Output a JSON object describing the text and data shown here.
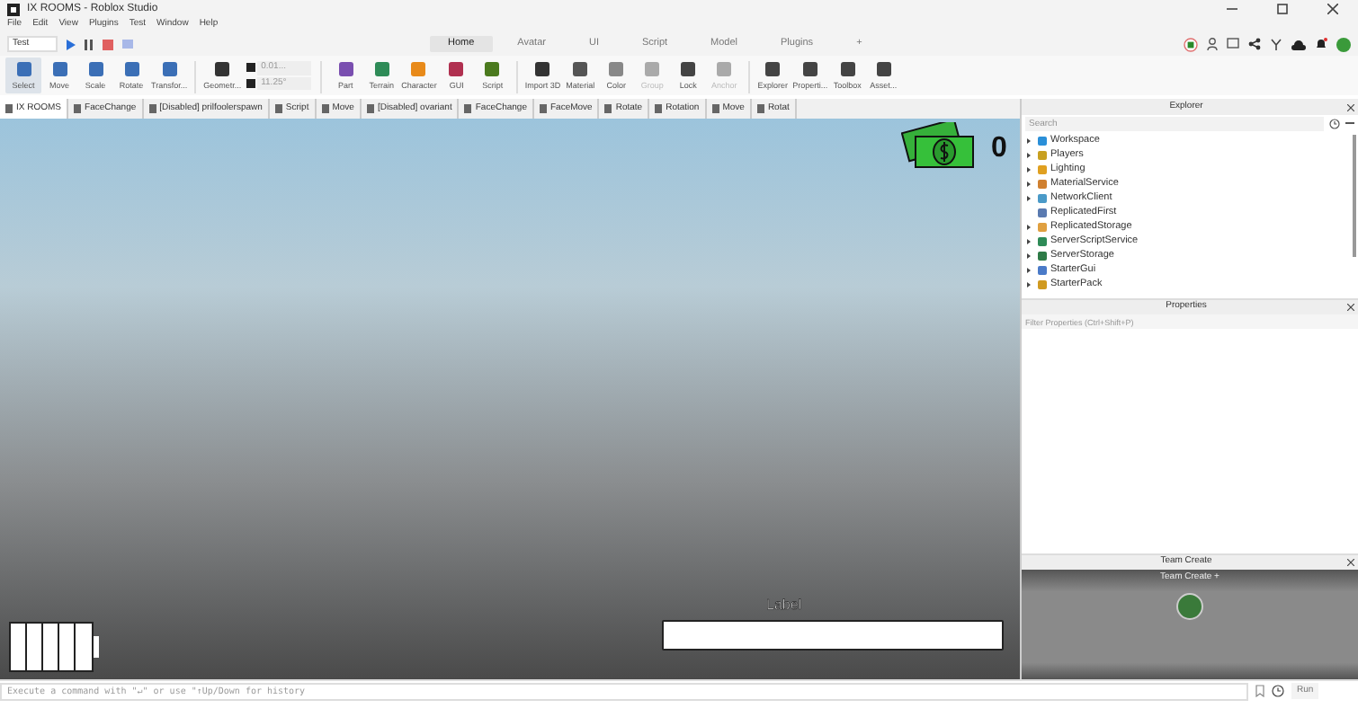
{
  "window": {
    "title": "IX ROOMS - Roblox Studio"
  },
  "menu": [
    "File",
    "Edit",
    "View",
    "Plugins",
    "Test",
    "Window",
    "Help"
  ],
  "test_dropdown": {
    "value": "Test"
  },
  "ribbon_tabs": [
    {
      "label": "Home",
      "selected": true
    },
    {
      "label": "Avatar",
      "selected": false
    },
    {
      "label": "UI",
      "selected": false
    },
    {
      "label": "Script",
      "selected": false
    },
    {
      "label": "Model",
      "selected": false
    },
    {
      "label": "Plugins",
      "selected": false
    },
    {
      "label": "+",
      "selected": false
    }
  ],
  "tools": [
    {
      "label": "Select",
      "color": "#3b6fb6",
      "selected": true,
      "disabled": false
    },
    {
      "label": "Move",
      "color": "#3b6fb6",
      "selected": false,
      "disabled": false
    },
    {
      "label": "Scale",
      "color": "#3b6fb6",
      "selected": false,
      "disabled": false
    },
    {
      "label": "Rotate",
      "color": "#3b6fb6",
      "selected": false,
      "disabled": false
    },
    {
      "label": "Transfor...",
      "color": "#3b6fb6",
      "selected": false,
      "disabled": false
    },
    {
      "label": "Geometr...",
      "color": "#333333",
      "selected": false,
      "disabled": false
    },
    {
      "label": "Part",
      "color": "#7a4fb0",
      "selected": false,
      "disabled": false
    },
    {
      "label": "Terrain",
      "color": "#2e8b57",
      "selected": false,
      "disabled": false
    },
    {
      "label": "Character",
      "color": "#e88a1a",
      "selected": false,
      "disabled": false
    },
    {
      "label": "GUI",
      "color": "#b03050",
      "selected": false,
      "disabled": false
    },
    {
      "label": "Script",
      "color": "#4b7a1e",
      "selected": false,
      "disabled": false
    },
    {
      "label": "Import 3D",
      "color": "#333333",
      "selected": false,
      "disabled": false
    },
    {
      "label": "Material",
      "color": "#555555",
      "selected": false,
      "disabled": false
    },
    {
      "label": "Color",
      "color": "#888888",
      "selected": false,
      "disabled": false
    },
    {
      "label": "Group",
      "color": "#aaaaaa",
      "selected": false,
      "disabled": true
    },
    {
      "label": "Lock",
      "color": "#444444",
      "selected": false,
      "disabled": false
    },
    {
      "label": "Anchor",
      "color": "#aaaaaa",
      "selected": false,
      "disabled": true
    },
    {
      "label": "Explorer",
      "color": "#444444",
      "selected": false,
      "disabled": false
    },
    {
      "label": "Properti...",
      "color": "#444444",
      "selected": false,
      "disabled": false
    },
    {
      "label": "Toolbox",
      "color": "#444444",
      "selected": false,
      "disabled": false
    },
    {
      "label": "Asset...",
      "color": "#444444",
      "selected": false,
      "disabled": false
    }
  ],
  "snap": [
    {
      "value": "0.01...",
      "checked": true
    },
    {
      "value": "11.25°",
      "checked": true
    }
  ],
  "doc_tabs": [
    {
      "label": "IX ROOMS",
      "selected": true
    },
    {
      "label": "FaceChange",
      "selected": false
    },
    {
      "label": "[Disabled] prilfoolerspawn",
      "selected": false
    },
    {
      "label": "Script",
      "selected": false
    },
    {
      "label": "Move",
      "selected": false
    },
    {
      "label": "[Disabled] ovariant",
      "selected": false
    },
    {
      "label": "FaceChange",
      "selected": false
    },
    {
      "label": "FaceMove",
      "selected": false
    },
    {
      "label": "Rotate",
      "selected": false
    },
    {
      "label": "Rotation",
      "selected": false
    },
    {
      "label": "Move",
      "selected": false
    },
    {
      "label": "Rotat",
      "selected": false
    }
  ],
  "viewport": {
    "money_count": "0",
    "label": "Label"
  },
  "explorer": {
    "title": "Explorer",
    "placeholder": "Search",
    "items": [
      {
        "label": "Workspace",
        "color": "#2a8fd8",
        "expandable": true
      },
      {
        "label": "Players",
        "color": "#c8a020",
        "expandable": true
      },
      {
        "label": "Lighting",
        "color": "#e0a020",
        "expandable": true
      },
      {
        "label": "MaterialService",
        "color": "#d08030",
        "expandable": true
      },
      {
        "label": "NetworkClient",
        "color": "#4a9ac8",
        "expandable": true
      },
      {
        "label": "ReplicatedFirst",
        "color": "#5a7ab0",
        "expandable": false
      },
      {
        "label": "ReplicatedStorage",
        "color": "#e0a040",
        "expandable": true
      },
      {
        "label": "ServerScriptService",
        "color": "#2e8b57",
        "expandable": true
      },
      {
        "label": "ServerStorage",
        "color": "#2e7b47",
        "expandable": true
      },
      {
        "label": "StarterGui",
        "color": "#4a7ac8",
        "expandable": true
      },
      {
        "label": "StarterPack",
        "color": "#d09a20",
        "expandable": true
      }
    ]
  },
  "properties": {
    "title": "Properties",
    "placeholder": "Filter Properties (Ctrl+Shift+P)"
  },
  "team_create": {
    "title": "Team Create",
    "heading": "Team Create +"
  },
  "command_bar": {
    "placeholder": "Execute a command with \"↵\" or use \"↑Up/Down for history"
  },
  "run_button": "Run"
}
